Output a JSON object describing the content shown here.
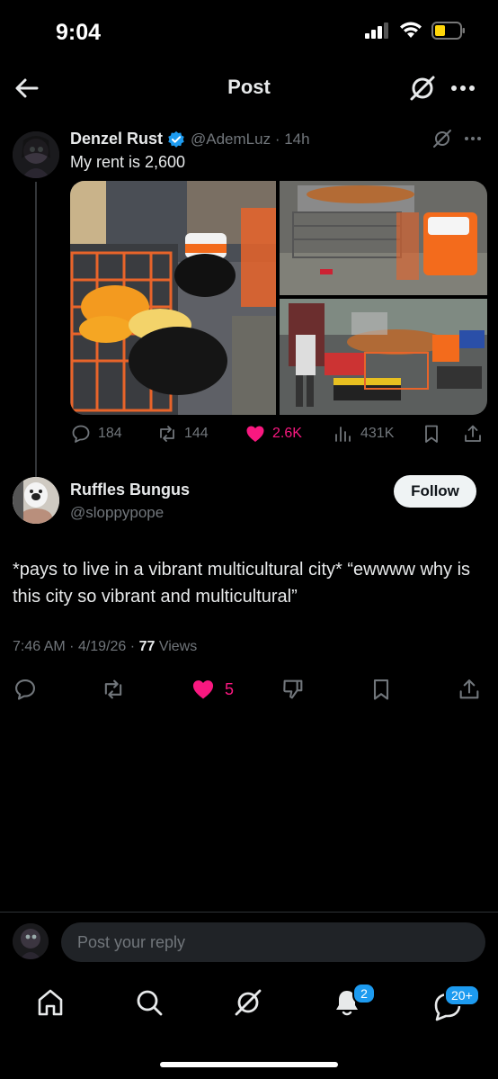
{
  "status_bar": {
    "time": "9:04"
  },
  "header": {
    "title": "Post"
  },
  "parent_post": {
    "author_name": "Denzel Rust",
    "author_handle": "@AdemLuz",
    "separator": "·",
    "age": "14h",
    "text": "My rent is 2,600",
    "stats": {
      "replies": "184",
      "reposts": "144",
      "likes": "2.6K",
      "views": "431K"
    }
  },
  "main_post": {
    "author_name": "Ruffles Bungus",
    "author_handle": "@sloppypope",
    "follow_label": "Follow",
    "text": "*pays to live in a vibrant multicultural city* “ewwww why is this city so vibrant and multicultural”",
    "time": "7:46 AM",
    "date": "4/19/26",
    "views_count": "77",
    "views_label": "Views",
    "sep": "·",
    "likes": "5"
  },
  "reply": {
    "placeholder": "Post your reply"
  },
  "bottom_nav": {
    "notifications_badge": "2",
    "messages_badge": "20+"
  },
  "colors": {
    "like": "#f91880",
    "verified": "#1d9bf0",
    "muted": "#71767b",
    "background": "#000000"
  }
}
